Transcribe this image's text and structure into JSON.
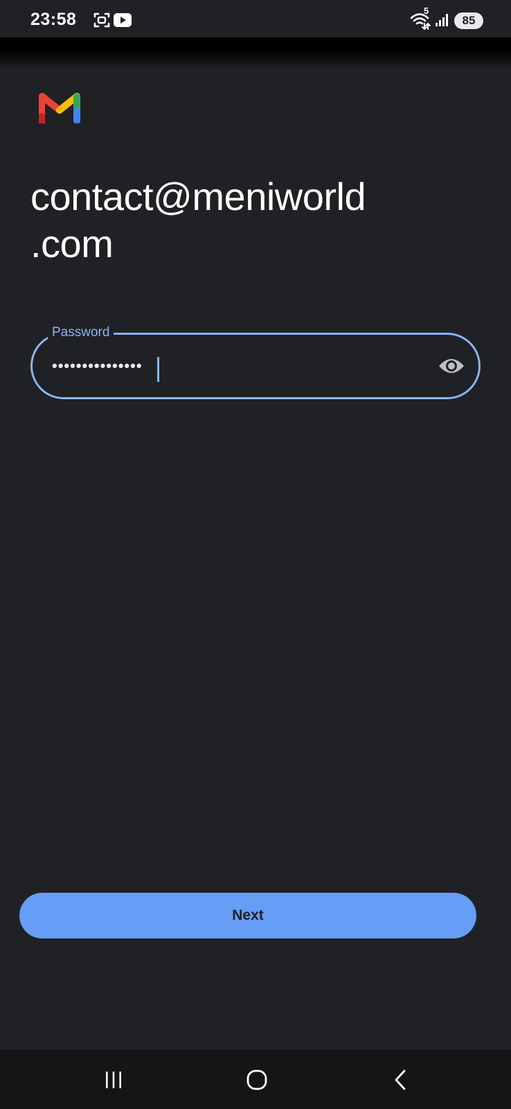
{
  "status_bar": {
    "time": "23:58",
    "battery": "85",
    "network_label": "5",
    "icons": [
      "screen-recorder-icon",
      "youtube-icon",
      "wifi-icon",
      "signal-icon",
      "battery-icon"
    ]
  },
  "app": {
    "logo": "gmail-logo"
  },
  "account": {
    "email_line1": "contact@meniworld",
    "email_line2": ".com"
  },
  "password": {
    "label": "Password",
    "masked_value": "•••••••••••••••",
    "toggle_icon": "eye-icon"
  },
  "actions": {
    "next_label": "Next"
  },
  "nav": {
    "items": [
      "recent-apps-icon",
      "home-icon",
      "back-icon"
    ]
  },
  "colors": {
    "background": "#202124",
    "accent": "#8ab4f8",
    "button": "#669df6"
  }
}
